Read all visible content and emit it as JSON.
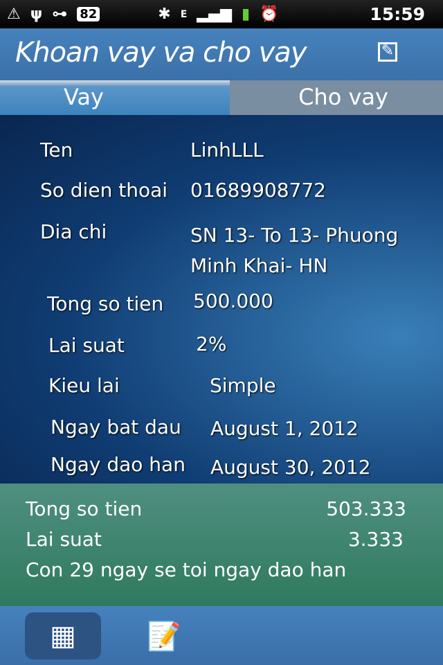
{
  "status": {
    "battery": "82",
    "time": "15:59",
    "network": "E"
  },
  "header": {
    "title": "Khoan vay va cho vay",
    "edit_icon": "edit-icon"
  },
  "tabs": [
    {
      "label": "Vay",
      "active": true
    },
    {
      "label": "Cho vay",
      "active": false
    }
  ],
  "details": [
    {
      "label": "Ten",
      "value": "LinhLLL"
    },
    {
      "label": "So dien thoai",
      "value": "01689908772"
    },
    {
      "label": "Dia chi",
      "value": "SN 13- To 13- Phuong Minh Khai- HN"
    },
    {
      "label": "Tong so tien",
      "value": "500.000"
    },
    {
      "label": "Lai suat",
      "value": "2%"
    },
    {
      "label": "Kieu lai",
      "value": "Simple"
    },
    {
      "label": "Ngay bat dau",
      "value": "August 1, 2012"
    },
    {
      "label": "Ngay dao han",
      "value": "August 30, 2012"
    }
  ],
  "summary": {
    "total_label": "Tong so tien",
    "total_value": "503.333",
    "interest_label": "Lai suat",
    "interest_value": "3.333",
    "remaining": "Con 29 ngay se toi ngay dao han"
  },
  "bottom_nav": [
    {
      "icon": "calendar-icon",
      "active": true
    },
    {
      "icon": "notes-icon",
      "active": false
    }
  ]
}
